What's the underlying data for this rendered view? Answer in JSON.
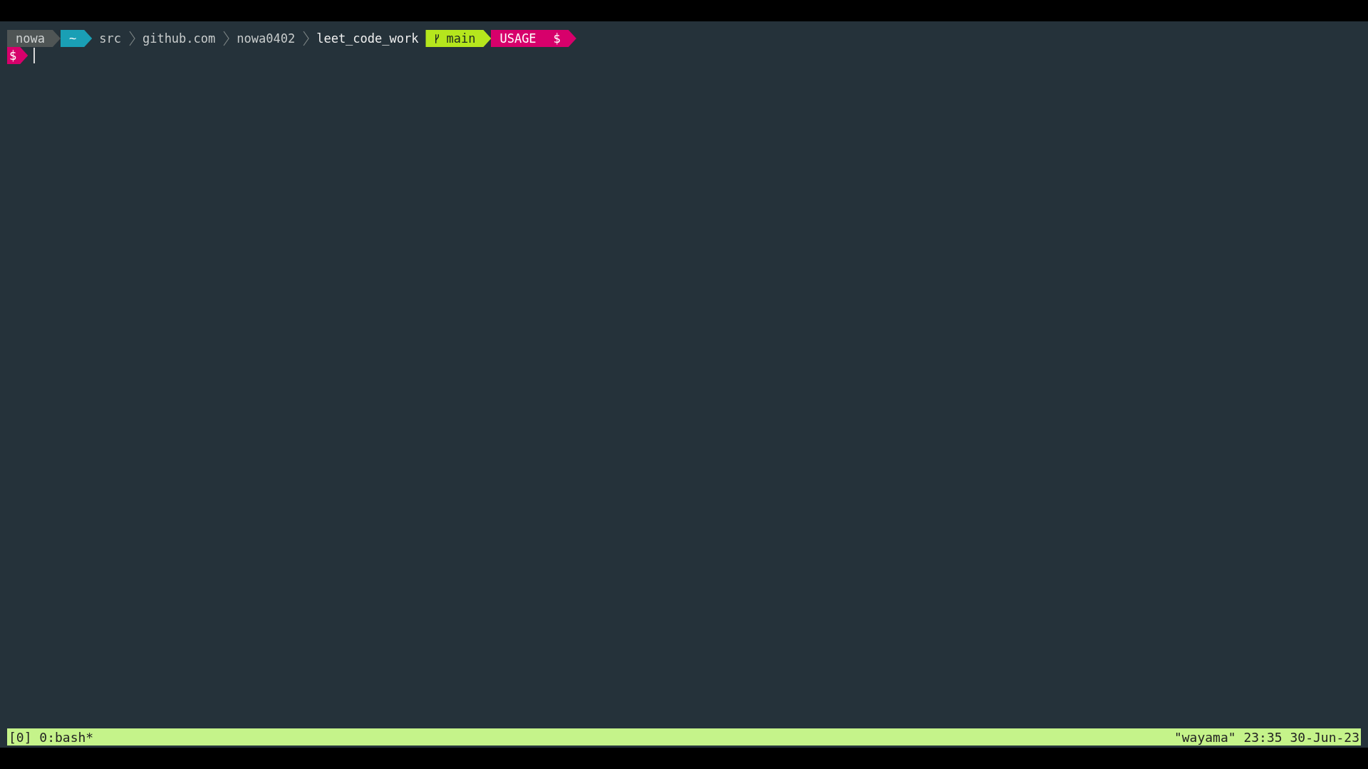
{
  "prompt": [
    {
      "kind": "user",
      "text": "nowa"
    },
    {
      "kind": "home",
      "text": "~"
    },
    {
      "kind": "dir",
      "text": "src"
    },
    {
      "kind": "dir",
      "text": "github.com"
    },
    {
      "kind": "dir",
      "text": "nowa0402"
    },
    {
      "kind": "cwd",
      "text": "leet_code_work"
    },
    {
      "kind": "git",
      "text": "main"
    },
    {
      "kind": "mode",
      "text": "USAGE"
    },
    {
      "kind": "symbol",
      "text": "$"
    }
  ],
  "input_prompt": {
    "symbol": "$"
  },
  "status_bar": {
    "session": "[0] 0:bash*",
    "right": "\"wayama\" 23:35 30-Jun-23"
  }
}
